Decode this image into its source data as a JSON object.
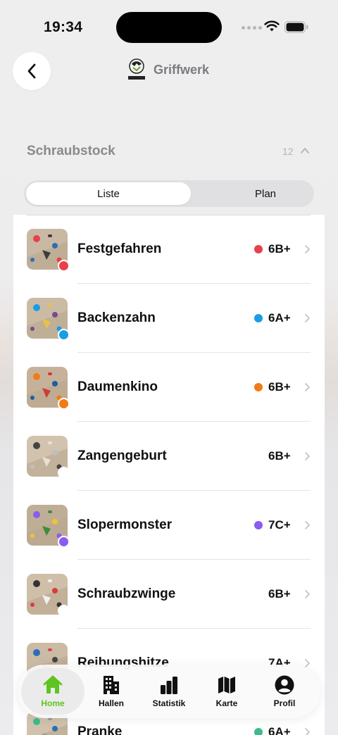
{
  "status_bar": {
    "time": "19:34"
  },
  "header": {
    "brand": "Griffwerk",
    "logo_text": "GRIFFWERK"
  },
  "section": {
    "title": "Schraubstock",
    "count": "12"
  },
  "segmented": {
    "list_label": "Liste",
    "plan_label": "Plan",
    "selected": "Liste"
  },
  "routes": [
    {
      "name": "Festgefahren",
      "grade": "6B+",
      "color": "#e8414a",
      "thumb_dot": "#e8414a",
      "has_grade_dot": true
    },
    {
      "name": "Backenzahn",
      "grade": "6A+",
      "color": "#1a9de3",
      "thumb_dot": "#1a9de3",
      "has_grade_dot": true
    },
    {
      "name": "Daumenkino",
      "grade": "6B+",
      "color": "#f17b16",
      "thumb_dot": "#f17b16",
      "has_grade_dot": true
    },
    {
      "name": "Zangengeburt",
      "grade": "6B+",
      "color": "#ffffff",
      "thumb_dot": "#ffffff",
      "has_grade_dot": false
    },
    {
      "name": "Slopermonster",
      "grade": "7C+",
      "color": "#8a5cf0",
      "thumb_dot": "#8a5cf0",
      "has_grade_dot": true
    },
    {
      "name": "Schraubzwinge",
      "grade": "6B+",
      "color": "#ffffff",
      "thumb_dot": "#ffffff",
      "has_grade_dot": false
    },
    {
      "name": "Reibungshitze",
      "grade": "7A+",
      "color": "#ffffff",
      "thumb_dot": "#ffffff",
      "has_grade_dot": false
    },
    {
      "name": "Pranke",
      "grade": "6A+",
      "color": "#3dbb8a",
      "thumb_dot": "#3dbb8a",
      "has_grade_dot": true
    }
  ],
  "tab_bar": {
    "tabs": [
      {
        "label": "Home",
        "icon": "house-icon",
        "active": true
      },
      {
        "label": "Hallen",
        "icon": "building-icon",
        "active": false
      },
      {
        "label": "Statistik",
        "icon": "bar-chart-icon",
        "active": false
      },
      {
        "label": "Karte",
        "icon": "map-icon",
        "active": false
      },
      {
        "label": "Profil",
        "icon": "person-icon",
        "active": false
      }
    ]
  },
  "colors": {
    "accent": "#5fc41f",
    "text": "#111111",
    "secondary": "#8a8a8e"
  }
}
